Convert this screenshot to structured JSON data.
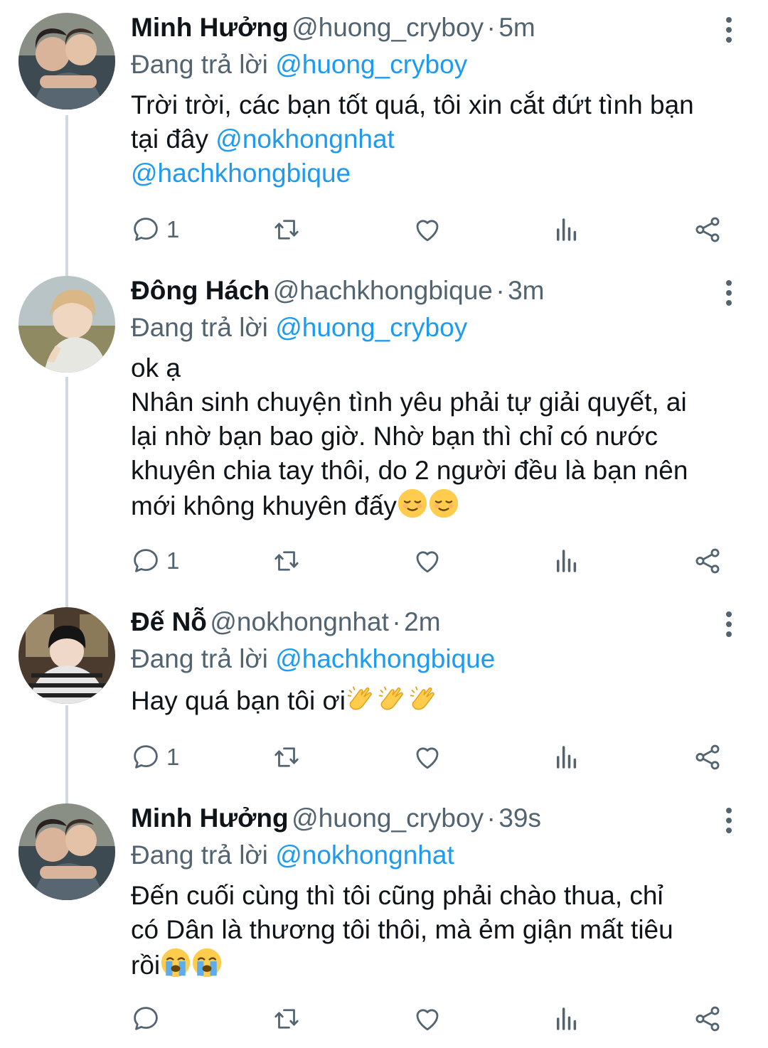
{
  "tweets": [
    {
      "name": "Minh Hưởng",
      "handle": "@huong_cryboy",
      "dot": "·",
      "time": "5m",
      "reply_prefix": "Đang trả lời",
      "reply_to": "@huong_cryboy",
      "text_1": "Trời trời, các bạn tốt quá, tôi xin cắt đứt tình bạn",
      "text_2": "tại đây",
      "mention_1": "@nokhongnhat",
      "mention_2": "@hachkhongbique",
      "reply_count": "1"
    },
    {
      "name": "Đông Hách",
      "handle": "@hachkhongbique",
      "dot": "·",
      "time": "3m",
      "reply_prefix": "Đang trả lời",
      "reply_to": "@huong_cryboy",
      "line_1": "ok ạ",
      "line_2": "Nhân sinh chuyện tình yêu phải tự giải quyết, ai",
      "line_3": "lại nhờ bạn bao giờ. Nhờ bạn thì chỉ có nước",
      "line_4": "khuyên chia tay thôi, do 2 người đều là bạn nên",
      "line_5": "mới không khuyên đấy",
      "emoji": "relieved-face-emoji",
      "reply_count": "1"
    },
    {
      "name": "Đế Nỗ",
      "handle": "@nokhongnhat",
      "dot": "·",
      "time": "2m",
      "reply_prefix": "Đang trả lời",
      "reply_to": "@hachkhongbique",
      "text": "Hay quá bạn tôi ơi",
      "emoji": "clapping-hands-emoji",
      "reply_count": "1"
    },
    {
      "name": "Minh Hưởng",
      "handle": "@huong_cryboy",
      "dot": "·",
      "time": "39s",
      "reply_prefix": "Đang trả lời",
      "reply_to": "@nokhongnhat",
      "line_1": "Đến cuối cùng thì tôi cũng phải chào thua, chỉ",
      "line_2": "có Dân là thương tôi thôi, mà ẻm giận mất tiêu",
      "line_3": "rồi",
      "emoji": "loudly-crying-face-emoji",
      "reply_count": ""
    }
  ],
  "colors": {
    "text": "#0f1419",
    "secondary": "#536471",
    "link": "#1d9bf0",
    "thread_line": "#cfd9de"
  }
}
